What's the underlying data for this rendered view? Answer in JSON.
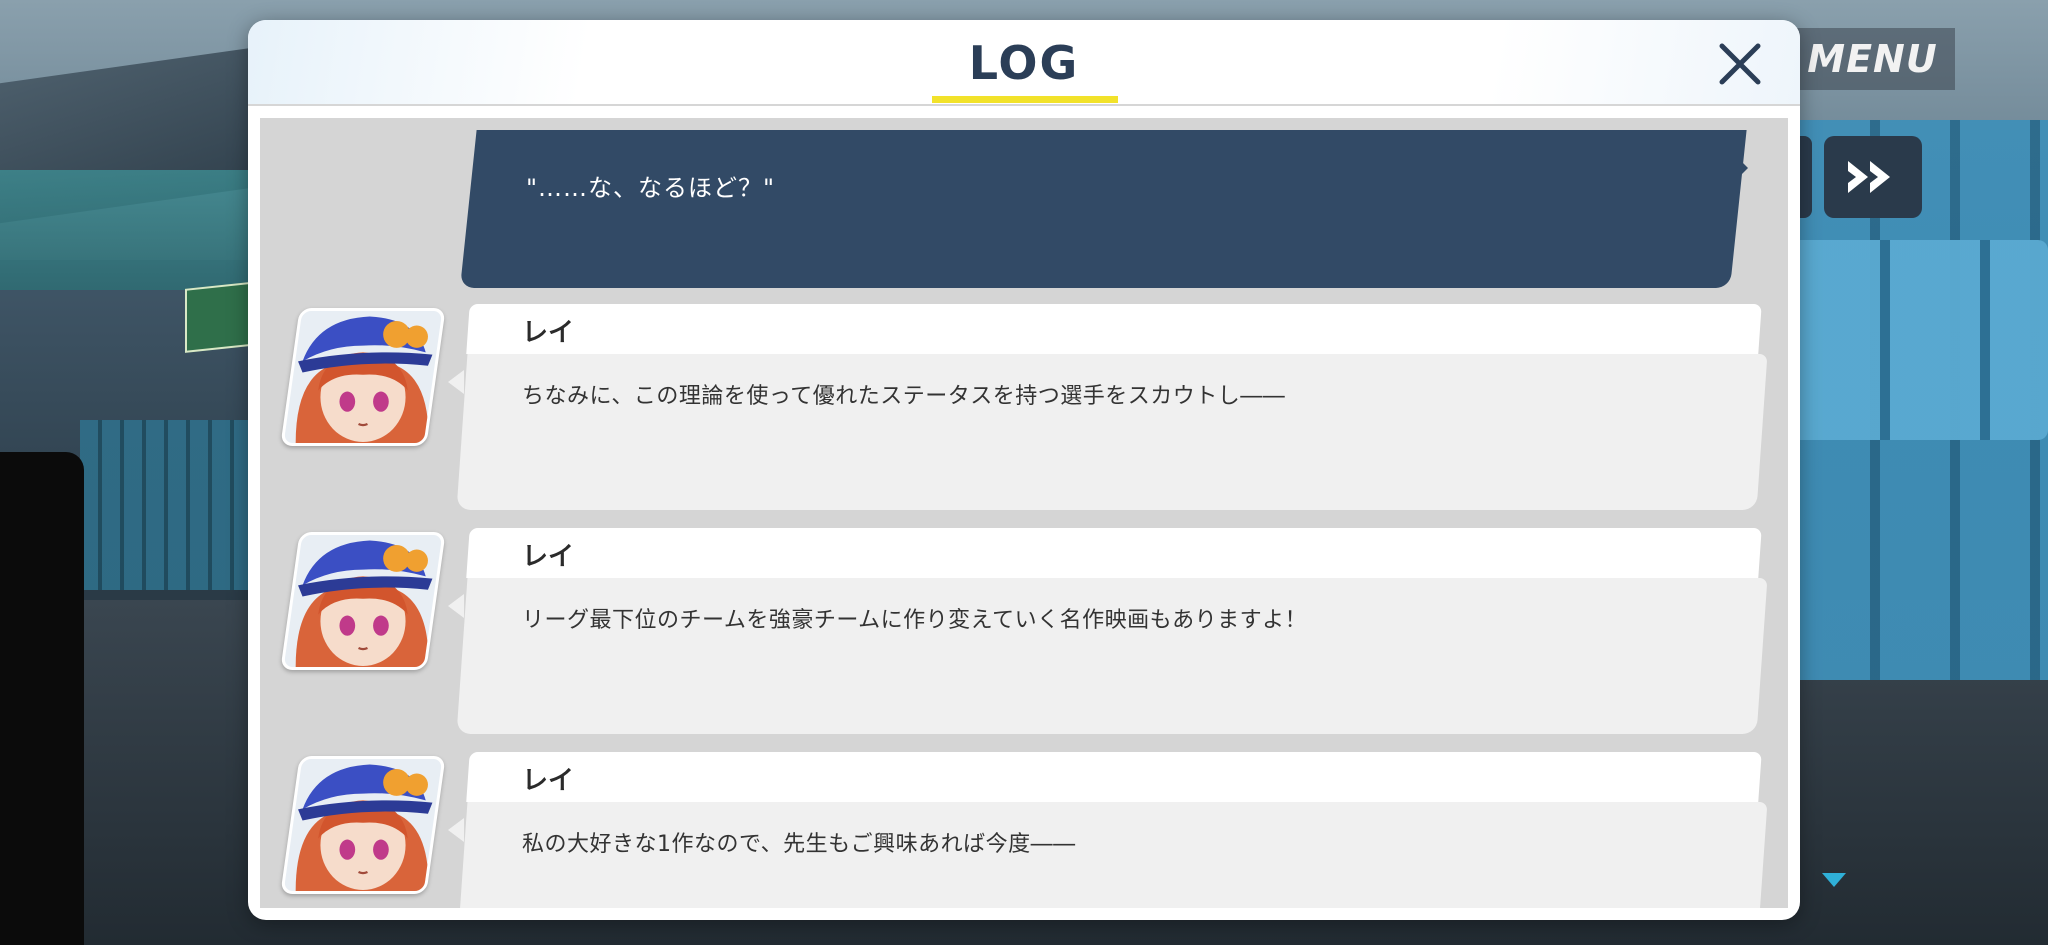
{
  "hud": {
    "menu_label": "MENU"
  },
  "log": {
    "title": "LOG",
    "narration": "\"……な、なるほど？\"",
    "entries": [
      {
        "speaker": "レイ",
        "text": "ちなみに、この理論を使って優れたステータスを持つ選手をスカウトし――"
      },
      {
        "speaker": "レイ",
        "text": "リーグ最下位のチームを強豪チームに作り変えていく名作映画もありますよ！"
      },
      {
        "speaker": "レイ",
        "text": "私の大好きな1作なので、先生もご興味あれば今度――"
      }
    ]
  },
  "colors": {
    "accent_yellow": "#f2e22a",
    "title_navy": "#2b3e57",
    "narration_bg": "#324a66",
    "scroll_indicator": "#2fb0d8"
  }
}
